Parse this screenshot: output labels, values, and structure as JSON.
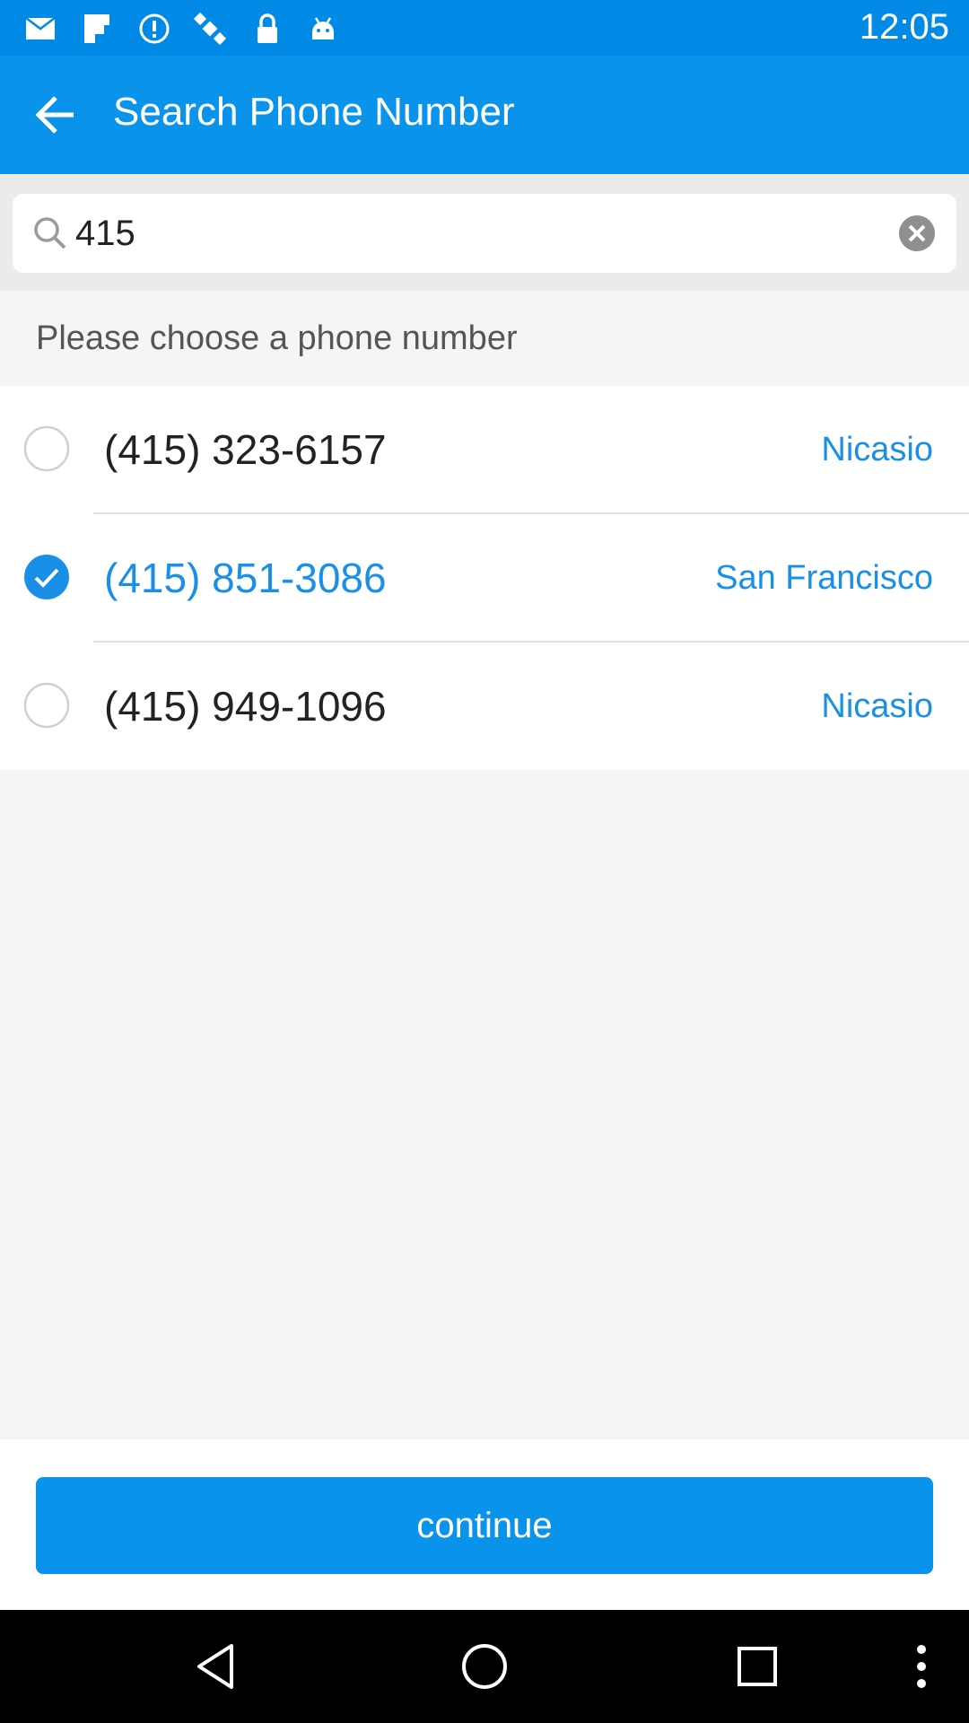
{
  "status_bar": {
    "time": "12:05",
    "icons": [
      "mail-icon",
      "flipboard-icon",
      "info-icon",
      "satellite-icon",
      "lock-icon",
      "android-icon"
    ]
  },
  "app_bar": {
    "title": "Search Phone Number",
    "back_icon": "arrow-left-icon"
  },
  "search": {
    "value": "415",
    "icon": "search-icon",
    "clear_icon": "clear-icon"
  },
  "prompt": "Please choose a phone number",
  "numbers": [
    {
      "phone": "(415) 323-6157",
      "city": "Nicasio",
      "selected": false
    },
    {
      "phone": "(415) 851-3086",
      "city": "San Francisco",
      "selected": true
    },
    {
      "phone": "(415) 949-1096",
      "city": "Nicasio",
      "selected": false
    }
  ],
  "continue_label": "continue",
  "nav": {
    "back_icon": "nav-back-icon",
    "home_icon": "nav-home-icon",
    "recents_icon": "nav-recents-icon",
    "menu_icon": "overflow-menu-icon"
  },
  "colors": {
    "accent": "#0a93eb",
    "status_bar": "#008ae6",
    "selected_text": "#1a8fe8"
  }
}
